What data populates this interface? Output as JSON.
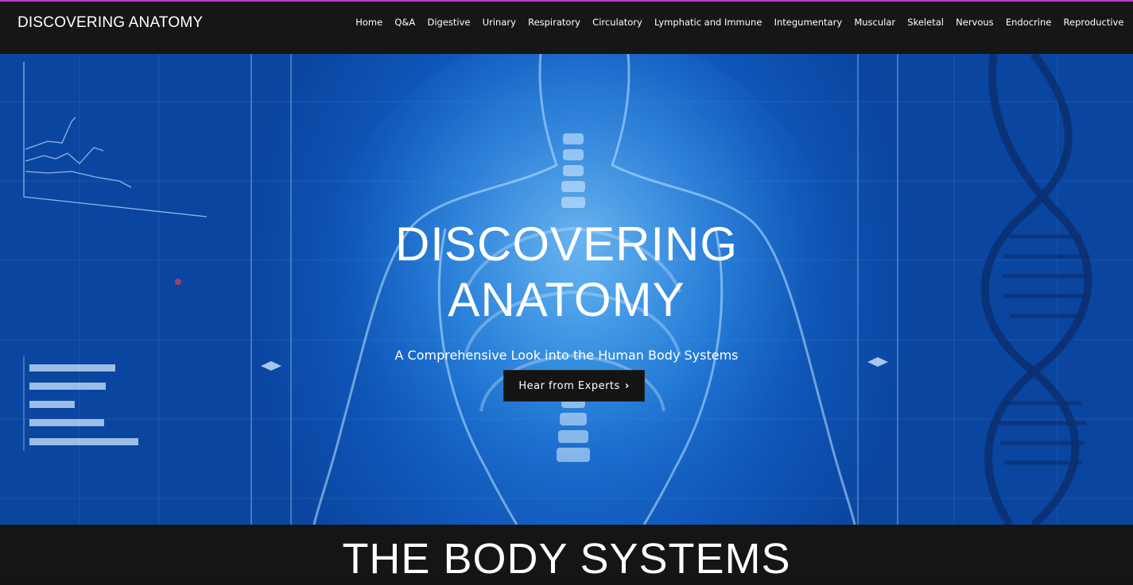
{
  "site": {
    "logo": "DISCOVERING ANATOMY"
  },
  "nav": {
    "items": [
      {
        "label": "Home"
      },
      {
        "label": "Q&A"
      },
      {
        "label": "Digestive"
      },
      {
        "label": "Urinary"
      },
      {
        "label": "Respiratory"
      },
      {
        "label": "Circulatory"
      },
      {
        "label": "Lymphatic and Immune"
      },
      {
        "label": "Integumentary"
      },
      {
        "label": "Muscular"
      },
      {
        "label": "Skeletal"
      },
      {
        "label": "Nervous"
      },
      {
        "label": "Endocrine"
      },
      {
        "label": "Reproductive"
      }
    ]
  },
  "hero": {
    "title_line1": "DISCOVERING",
    "title_line2": "ANATOMY",
    "subtitle": "A Comprehensive Look into the Human Body Systems",
    "cta_label": "Hear from Experts",
    "cta_icon": "chevron-right-icon"
  },
  "systems": {
    "heading": "THE BODY SYSTEMS"
  },
  "colors": {
    "accent_line": "#c03ac8",
    "header_bg": "#161616",
    "hero_blue": "#1a6ccd",
    "button_bg": "#141414"
  }
}
